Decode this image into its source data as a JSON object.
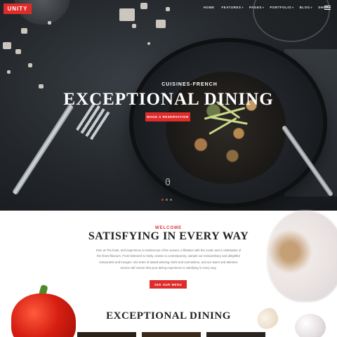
{
  "brand": {
    "logo_text": "UNITY",
    "accent_color": "#e02b2b"
  },
  "nav": {
    "items": [
      {
        "label": "HOME",
        "has_dropdown": false
      },
      {
        "label": "FEATURES",
        "has_dropdown": true
      },
      {
        "label": "PAGES",
        "has_dropdown": true
      },
      {
        "label": "PORTFOLIO",
        "has_dropdown": true
      },
      {
        "label": "BLOG",
        "has_dropdown": true
      },
      {
        "label": "SHOP",
        "has_dropdown": true
      }
    ],
    "menu_icon": "hamburger-icon"
  },
  "hero": {
    "subtitle": "CUISINES-FRENCH",
    "title": "EXCEPTIONAL DINING",
    "button_label": "MAKE A RESERVATION",
    "slides_count": 3,
    "active_slide": 1
  },
  "welcome": {
    "kicker": "WELCOME",
    "title": "SATISFYING IN EVERY WAY",
    "text": "Dine at The hotel, and experience a rendezvous of the senses, a flirtation with the exotic and a celebration of the finest flavours. From bistroeck to lively, classic to contemporary, sample our extraordinary and delightful restaurants and lounges. Our team of award-winning chefs and sommeliers, and our warm and attentive service will ensure that your dining experience is satisfying in every way.",
    "button_label": "SEE OUR MENU"
  },
  "next_section": {
    "title": "EXCEPTIONAL DINING"
  }
}
